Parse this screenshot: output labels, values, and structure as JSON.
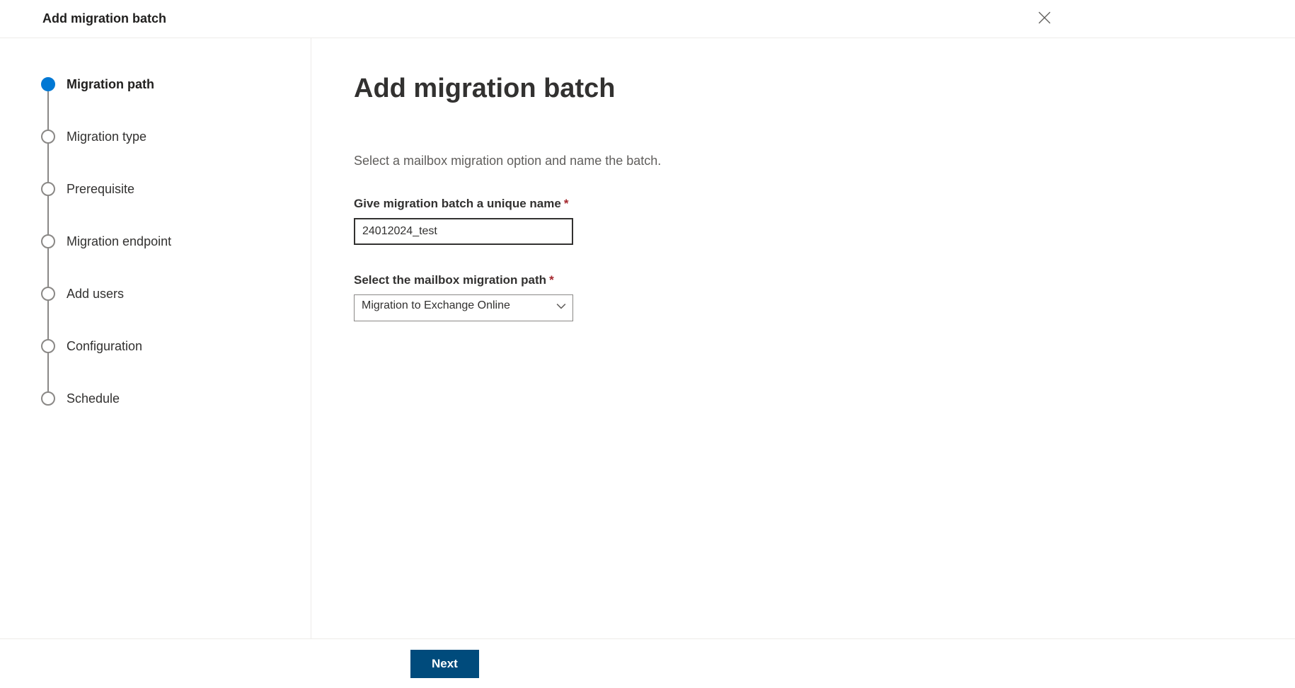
{
  "header": {
    "title": "Add migration batch"
  },
  "sidebar": {
    "steps": [
      {
        "label": "Migration path",
        "active": true
      },
      {
        "label": "Migration type",
        "active": false
      },
      {
        "label": "Prerequisite",
        "active": false
      },
      {
        "label": "Migration endpoint",
        "active": false
      },
      {
        "label": "Add users",
        "active": false
      },
      {
        "label": "Configuration",
        "active": false
      },
      {
        "label": "Schedule",
        "active": false
      }
    ]
  },
  "main": {
    "title": "Add migration batch",
    "subtitle": "Select a mailbox migration option and name the batch.",
    "form": {
      "name_label": "Give migration batch a unique name",
      "name_value": "24012024_test",
      "path_label": "Select the mailbox migration path",
      "path_value": "Migration to Exchange Online"
    }
  },
  "footer": {
    "next_label": "Next"
  }
}
